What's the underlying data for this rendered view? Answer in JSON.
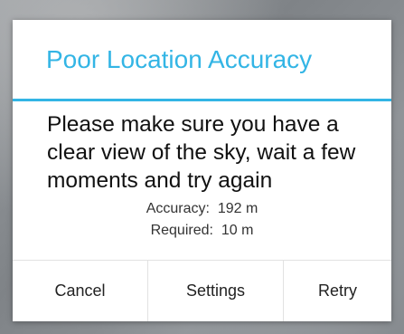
{
  "dialog": {
    "title": "Poor Location Accuracy",
    "message": "Please make sure you have a clear view of the sky, wait a few moments and try again",
    "accuracy_label": "Accuracy:",
    "accuracy_value": "192 m",
    "required_label": "Required:",
    "required_value": "10 m",
    "accent_color": "#33b5e5",
    "buttons": {
      "cancel": "Cancel",
      "settings": "Settings",
      "retry": "Retry"
    }
  }
}
